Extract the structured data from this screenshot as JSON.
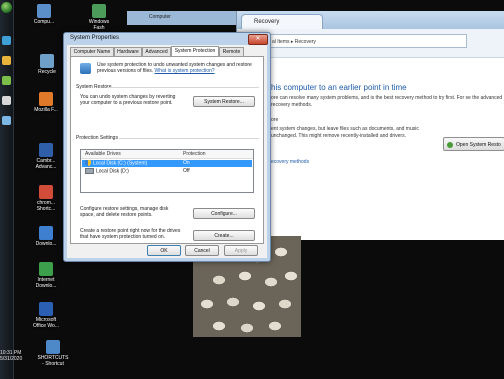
{
  "taskbar": {
    "clock_time": "10:31 PM",
    "clock_date": "5/31/2020"
  },
  "desktop_icons": [
    {
      "label": "Compu..."
    },
    {
      "label": "Recycle"
    },
    {
      "label": "Mozilla F..."
    },
    {
      "label": "Cambr... Advanc..."
    },
    {
      "label": "chrom... Shortc..."
    },
    {
      "label": "Downlo..."
    },
    {
      "label": "Internet Downlo..."
    },
    {
      "label": "Microsoft Office Wo..."
    },
    {
      "label": "SHORTCUTS - Shortcut"
    },
    {
      "label": "Windows Fash"
    }
  ],
  "computer_window": {
    "tab_label": "Computer"
  },
  "recovery_window": {
    "tab_label": "Recovery",
    "address": "al Items ▸ Recovery",
    "heading": "his computer to an earlier point in time",
    "description": "ore can resolve many system problems, and is the best recovery method to try first. For se the advanced recovery methods.",
    "subheading": "ore",
    "restore_text": "ent system changes, but leave files such as documents, and music unchanged. This might remove recently-installed and drivers.",
    "open_restore_button": "Open System Resto",
    "advanced_link": "ecovery methods"
  },
  "system_properties": {
    "title": "System Properties",
    "tabs": [
      {
        "label": "Computer Name",
        "active": false
      },
      {
        "label": "Hardware",
        "active": false
      },
      {
        "label": "Advanced",
        "active": false
      },
      {
        "label": "System Protection",
        "active": true
      },
      {
        "label": "Remote",
        "active": false
      }
    ],
    "intro_text": "Use system protection to undo unwanted system changes and restore previous versions of files.",
    "intro_link": "What is system protection?",
    "system_restore_heading": "System Restore",
    "system_restore_text": "You can undo system changes by reverting your computer to a previous restore point.",
    "system_restore_button": "System Restore...",
    "protection_heading": "Protection Settings",
    "columns": {
      "drives": "Available Drives",
      "protection": "Protection"
    },
    "drives": [
      {
        "name": "Local Disk (C:) (System)",
        "protection": "On",
        "selected": true
      },
      {
        "name": "Local Disk (D:)",
        "protection": "Off",
        "selected": false
      }
    ],
    "configure_text": "Configure restore settings, manage disk space, and delete restore points.",
    "configure_button": "Configure...",
    "create_text": "Create a restore point right now for the drives that have system protection turned on.",
    "create_button": "Create...",
    "ok_button": "OK",
    "cancel_button": "Cancel",
    "apply_button": "Apply"
  }
}
